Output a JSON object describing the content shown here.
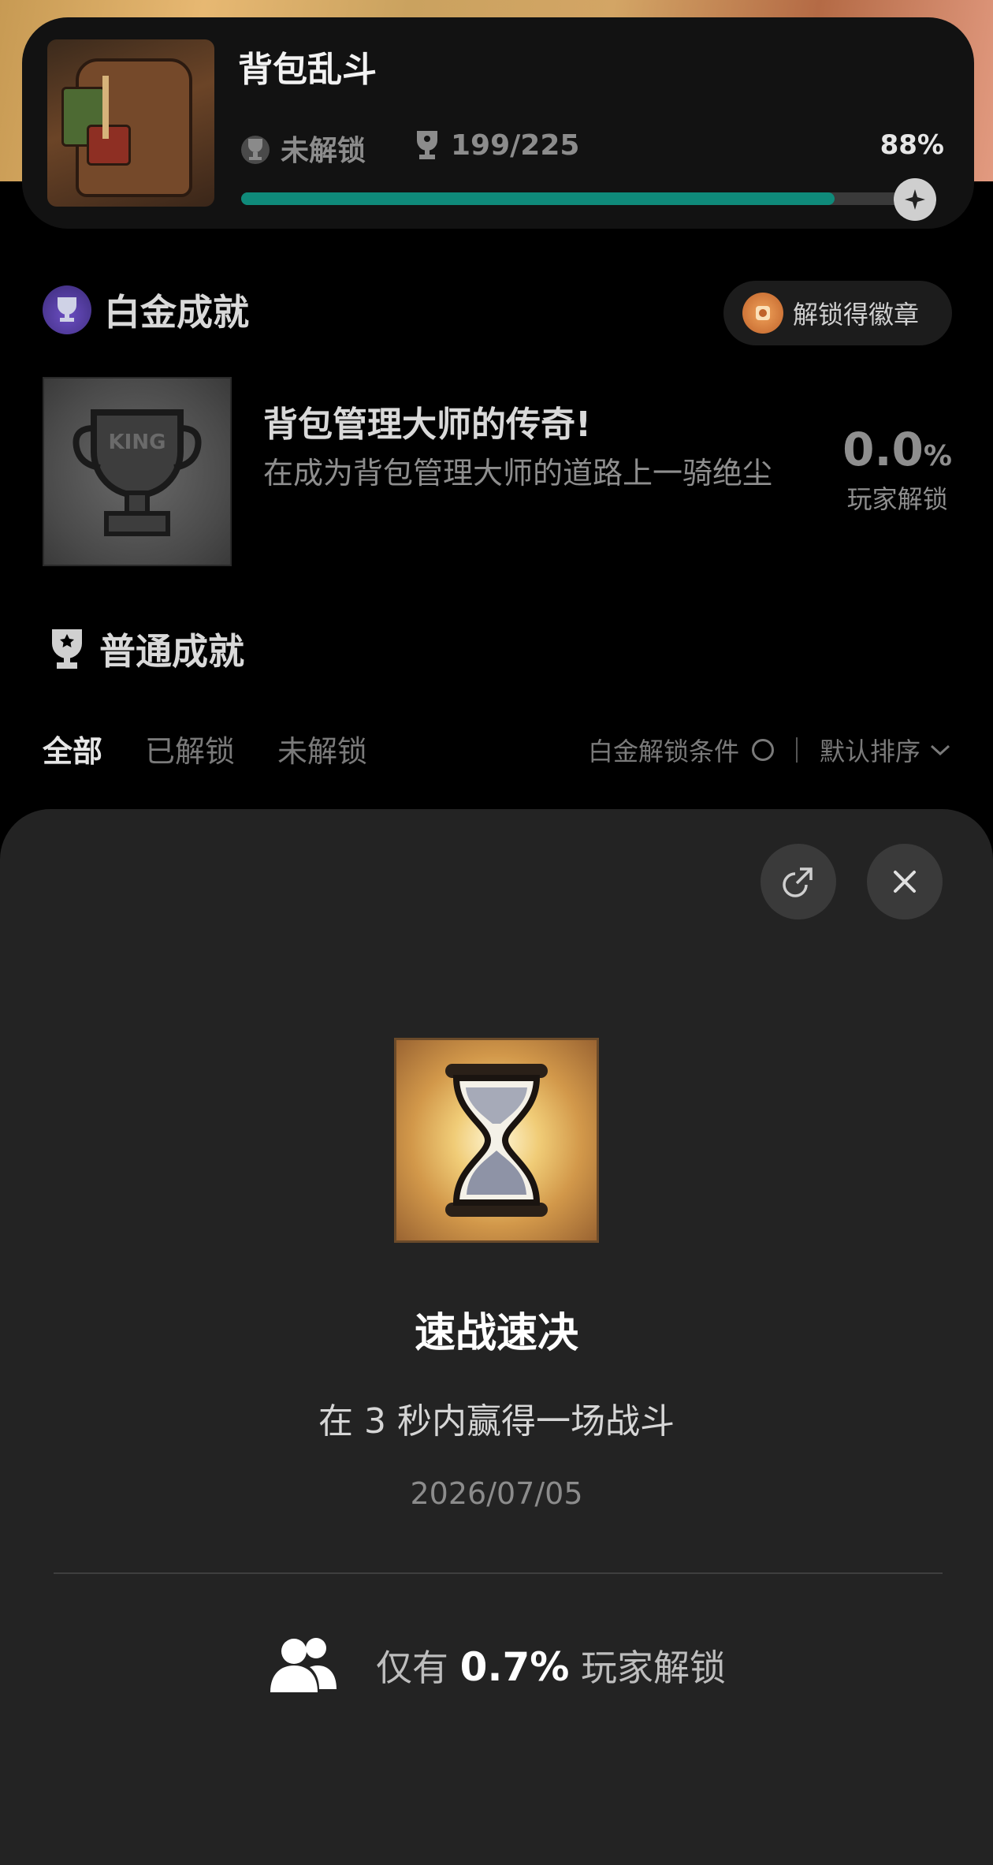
{
  "game": {
    "title": "背包乱斗",
    "unlock_status": "未解锁",
    "trophy_count": "199/225",
    "progress_percent_label": "88%",
    "progress_fraction": 0.88
  },
  "platinum": {
    "section_title": "白金成就",
    "badge_button_label": "解锁得徽章",
    "achievement_name": "背包管理大师的传奇!",
    "achievement_desc": "在成为背包管理大师的道路上一骑绝尘",
    "rate_number": "0.0",
    "rate_unit": "%",
    "rate_label": "玩家解锁",
    "image_text": "KING"
  },
  "normal": {
    "section_title": "普通成就",
    "tabs": [
      "全部",
      "已解锁",
      "未解锁"
    ],
    "active_tab_index": 0,
    "condition_label": "白金解锁条件",
    "sort_label": "默认排序"
  },
  "detail_sheet": {
    "achievement_title": "速战速决",
    "achievement_desc": "在 3 秒内赢得一场战斗",
    "date": "2026/07/05",
    "rarity_prefix": "仅有",
    "rarity_value": "0.7%",
    "rarity_suffix": "玩家解锁"
  },
  "icons": {
    "share": "share-icon",
    "close": "close-icon",
    "users": "users-icon",
    "trophy": "trophy-icon",
    "chevron": "chevron-down-icon"
  },
  "colors": {
    "accent": "#0f8a7a",
    "sheet_bg": "#232323",
    "page_bg": "#000000"
  }
}
